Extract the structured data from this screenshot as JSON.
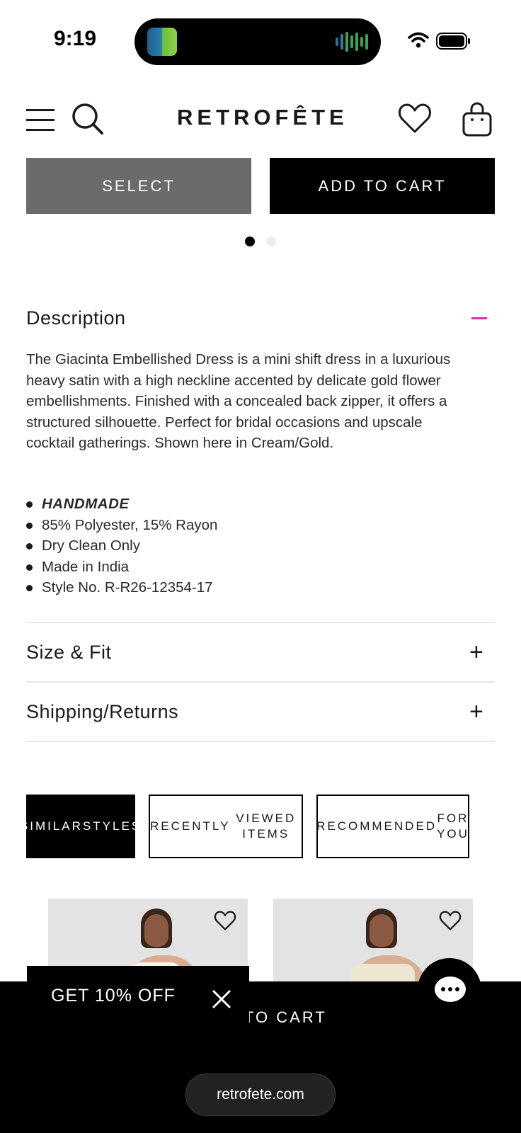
{
  "status_bar": {
    "time": "9:19"
  },
  "header": {
    "logo": "RETROFÊTE"
  },
  "product_actions": {
    "select_label": "SELECT",
    "add_to_cart_label": "ADD TO CART"
  },
  "description": {
    "title": "Description",
    "body": "The Giacinta Embellished Dress is a mini shift dress in a luxurious heavy satin with a high neckline accented by delicate gold flower embellishments. Finished with a concealed back zipper, it offers a structured silhouette. Perfect for bridal occasions and upscale cocktail gatherings. Shown here in Cream/Gold.",
    "bullets": [
      "HANDMADE",
      "85% Polyester, 15% Rayon",
      "Dry Clean Only",
      "Made in India",
      "Style No. R-R26-12354-17"
    ]
  },
  "accordions": [
    {
      "label": "Size & Fit"
    },
    {
      "label": "Shipping/Returns"
    }
  ],
  "tabs": [
    {
      "label": "SIMILAR STYLES"
    },
    {
      "label": "RECENTLY VIEWED ITEMS"
    },
    {
      "label": "RECOMMENDED FOR YOU"
    }
  ],
  "promo": {
    "text": "GET 10% OFF"
  },
  "sticky_cart": {
    "label": "TO CART"
  },
  "browser": {
    "url": "retrofete.com"
  },
  "colors": {
    "accent": "#d6339a",
    "primary": "#000000",
    "select_bg": "#6b6b6b"
  }
}
